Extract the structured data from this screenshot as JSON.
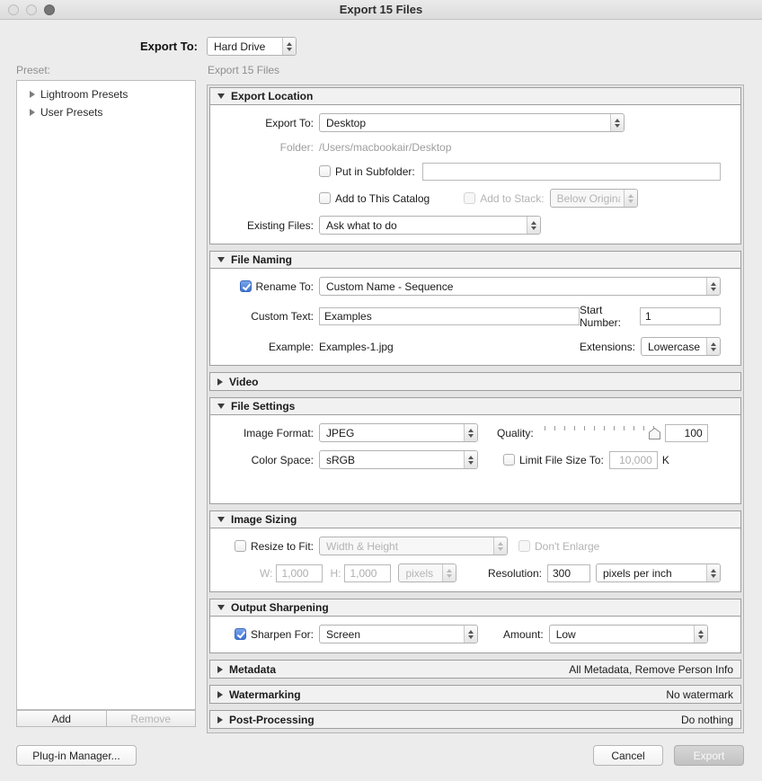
{
  "window": {
    "title": "Export 15 Files"
  },
  "toolbar": {
    "export_to_label": "Export To:",
    "export_to_value": "Hard Drive"
  },
  "sidebar": {
    "preset_label": "Preset:",
    "items": [
      "Lightroom Presets",
      "User Presets"
    ],
    "add_label": "Add",
    "remove_label": "Remove"
  },
  "panel": {
    "header": "Export 15 Files",
    "export_location": {
      "title": "Export Location",
      "export_to_label": "Export To:",
      "export_to_value": "Desktop",
      "folder_label": "Folder:",
      "folder_value": "/Users/macbookair/Desktop",
      "put_in_subfolder_label": "Put in Subfolder:",
      "subfolder_value": "",
      "add_to_catalog_label": "Add to This Catalog",
      "add_to_stack_label": "Add to Stack:",
      "add_to_stack_value": "Below Original",
      "existing_files_label": "Existing Files:",
      "existing_files_value": "Ask what to do"
    },
    "file_naming": {
      "title": "File Naming",
      "rename_to_label": "Rename To:",
      "rename_to_value": "Custom Name - Sequence",
      "custom_text_label": "Custom Text:",
      "custom_text_value": "Examples",
      "start_number_label": "Start Number:",
      "start_number_value": "1",
      "example_label": "Example:",
      "example_value": "Examples-1.jpg",
      "extensions_label": "Extensions:",
      "extensions_value": "Lowercase"
    },
    "video": {
      "title": "Video"
    },
    "file_settings": {
      "title": "File Settings",
      "image_format_label": "Image Format:",
      "image_format_value": "JPEG",
      "quality_label": "Quality:",
      "quality_value": "100",
      "color_space_label": "Color Space:",
      "color_space_value": "sRGB",
      "limit_file_size_label": "Limit File Size To:",
      "limit_file_size_value": "10,000",
      "limit_file_size_unit": "K"
    },
    "image_sizing": {
      "title": "Image Sizing",
      "resize_to_fit_label": "Resize to Fit:",
      "resize_to_fit_value": "Width & Height",
      "dont_enlarge_label": "Don't Enlarge",
      "w_label": "W:",
      "w_value": "1,000",
      "h_label": "H:",
      "h_value": "1,000",
      "unit_value": "pixels",
      "resolution_label": "Resolution:",
      "resolution_value": "300",
      "resolution_unit_value": "pixels per inch"
    },
    "output_sharpening": {
      "title": "Output Sharpening",
      "sharpen_for_label": "Sharpen For:",
      "sharpen_for_value": "Screen",
      "amount_label": "Amount:",
      "amount_value": "Low"
    },
    "metadata": {
      "title": "Metadata",
      "status": "All Metadata, Remove Person Info"
    },
    "watermarking": {
      "title": "Watermarking",
      "status": "No watermark"
    },
    "post_processing": {
      "title": "Post-Processing",
      "status": "Do nothing"
    }
  },
  "footer": {
    "plugin_manager_label": "Plug-in Manager...",
    "cancel_label": "Cancel",
    "export_label": "Export"
  },
  "icons": {
    "disclosure_expanded": "triangle-down",
    "disclosure_collapsed": "triangle-right",
    "dropdown_stepper": "chevron-up-down"
  },
  "colors": {
    "checkbox_accent": "#3f74d4",
    "window_background": "#ececec"
  }
}
